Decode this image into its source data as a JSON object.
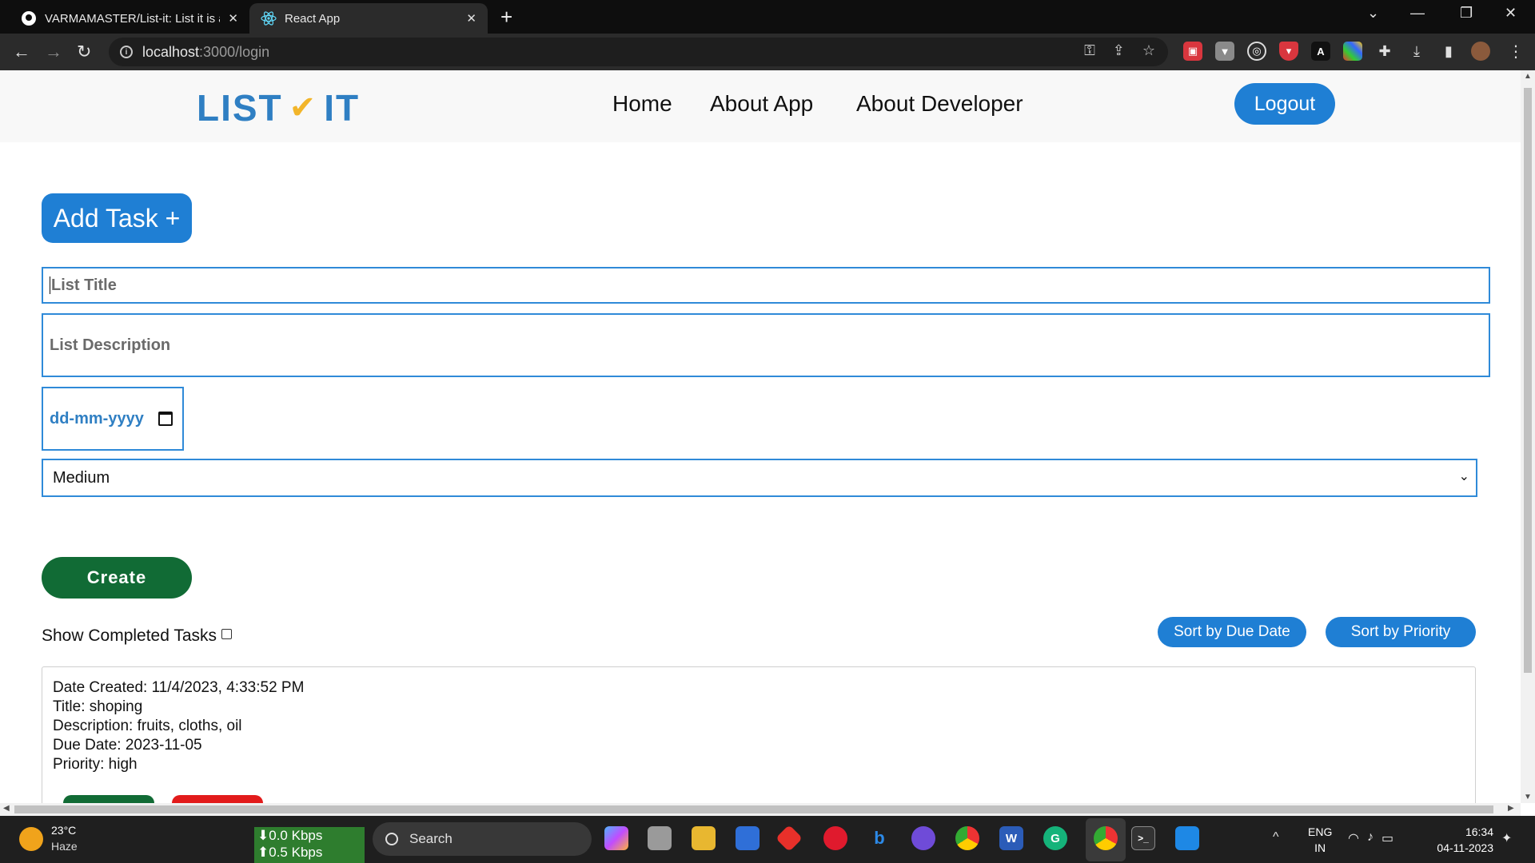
{
  "browser": {
    "tabs": [
      {
        "title": "VARMAMASTER/List-it: List it is a",
        "close": "✕"
      },
      {
        "title": "React App",
        "close": "✕"
      }
    ],
    "new_tab": "+",
    "url_host": "localhost",
    "url_path": ":3000/login",
    "window_controls": {
      "chevron": "⌄",
      "minimize": "—",
      "restore": "❐",
      "close": "✕"
    }
  },
  "header": {
    "logo_left": "LIST",
    "logo_right": "IT",
    "nav": [
      "Home",
      "About App",
      "About Developer"
    ],
    "logout": "Logout"
  },
  "form": {
    "add_task": "Add Task +",
    "title_placeholder": "List Title",
    "description_placeholder": "List Description",
    "date_placeholder": "dd-mm-yyyy",
    "priority_selected": "Medium",
    "create": "Create"
  },
  "controls": {
    "show_completed": "Show Completed Tasks",
    "sort_due": "Sort by Due Date",
    "sort_priority": "Sort by Priority"
  },
  "tasks": [
    {
      "date_created": "Date Created: 11/4/2023, 4:33:52 PM",
      "title": "Title: shoping",
      "description": "Description: fruits, cloths, oil",
      "due_date": "Due Date: 2023-11-05",
      "priority": "Priority: high"
    }
  ],
  "taskbar": {
    "weather_temp": "23°C",
    "weather_desc": "Haze",
    "net_down": "⬇0.0 Kbps",
    "net_up": "⬆0.5 Kbps",
    "search": "Search",
    "lang_top": "ENG",
    "lang_bottom": "IN",
    "time": "16:34",
    "date": "04-11-2023"
  },
  "colors": {
    "brand_blue": "#1f7fd4",
    "create_green": "#116b35",
    "delete_red": "#e21b1b",
    "logo_check": "#f2b52a"
  }
}
